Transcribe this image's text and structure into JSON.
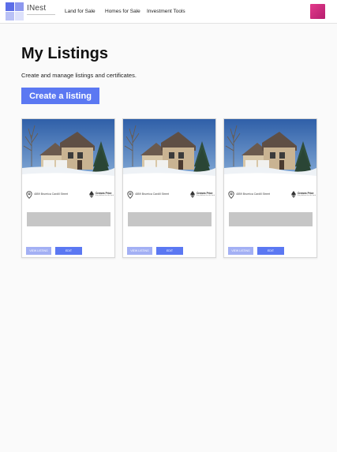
{
  "header": {
    "logo_text": "INest",
    "nav": [
      {
        "label": "Land for Sale"
      },
      {
        "label": "Homes for Sale"
      },
      {
        "label": "Investment Tools"
      }
    ],
    "avatar_color": "#d42e80"
  },
  "main": {
    "title": "My Listings",
    "subtitle": "Create and manage listings and certificates.",
    "create_button": "Create a listing",
    "accent_color": "#5b78f2"
  },
  "listings": [
    {
      "address": "4859 Bruerica Cardill Street",
      "brand": "Crowns Price",
      "brand_sub": "the platform for the land",
      "view_label": "VIEW LISTING",
      "edit_label": "EDIT"
    },
    {
      "address": "4859 Bruerica Cardill Street",
      "brand": "Crowns Price",
      "brand_sub": "the platform for the land",
      "view_label": "VIEW LISTING",
      "edit_label": "EDIT"
    },
    {
      "address": "4859 Bruerica Cardill Street",
      "brand": "Crowns Price",
      "brand_sub": "the platform for the land",
      "view_label": "VIEW LISTING",
      "edit_label": "EDIT"
    }
  ],
  "icons": {
    "location": "map-pin-icon",
    "brand": "ethereum-icon",
    "avatar": "user-avatar"
  }
}
